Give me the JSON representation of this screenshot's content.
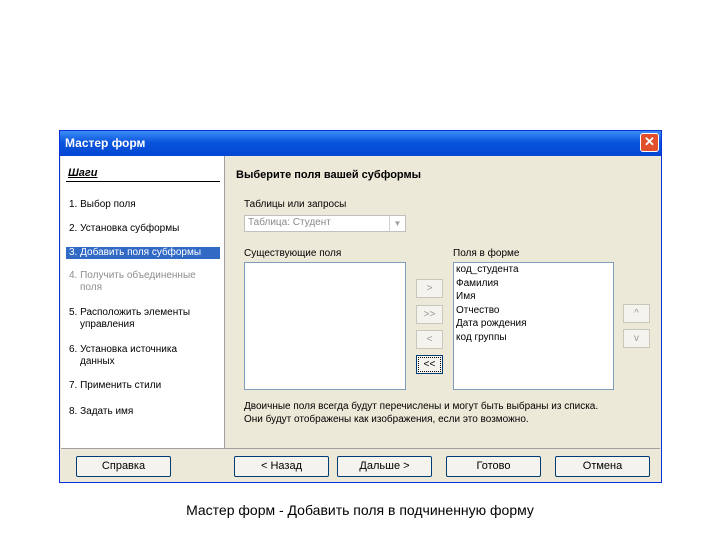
{
  "window": {
    "title": "Мастер форм",
    "close_symbol": "✕"
  },
  "steps": {
    "header": "Шаги",
    "items": [
      {
        "label": "1. Выбор поля",
        "state": "normal"
      },
      {
        "label": "2. Установка субформы",
        "state": "normal"
      },
      {
        "label": "3. Добавить поля субформы",
        "state": "active"
      },
      {
        "label": "4. Получить объединенные",
        "label2": "поля",
        "state": "disabled"
      },
      {
        "label": "5. Расположить элементы",
        "label2": "управления",
        "state": "normal"
      },
      {
        "label": "6. Установка источника",
        "label2": "данных",
        "state": "normal"
      },
      {
        "label": "7. Применить стили",
        "state": "normal"
      },
      {
        "label": "8. Задать имя",
        "state": "normal"
      }
    ]
  },
  "main": {
    "heading": "Выберите поля вашей субформы",
    "tables_label": "Таблицы или запросы",
    "table_select": "Таблица: Студент",
    "existing_label": "Существующие поля",
    "existing_fields": [],
    "form_fields_label": "Поля в форме",
    "form_fields": [
      "код_студента",
      "Фамилия",
      "Имя",
      "Отчество",
      "Дата рождения",
      "код группы"
    ],
    "move_buttons": {
      "add": ">",
      "add_all": ">>",
      "remove": "<",
      "remove_all": "<<"
    },
    "order_buttons": {
      "up": "^",
      "down": "v"
    },
    "note_line1": "Двоичные поля всегда будут перечислены и могут быть выбраны из списка.",
    "note_line2": "Они будут отображены как изображения, если это возможно."
  },
  "footer": {
    "help": "Справка",
    "back": "< Назад",
    "next": "Дальше >",
    "finish": "Готово",
    "cancel": "Отмена"
  },
  "caption": "Мастер форм - Добавить поля в подчиненную форму"
}
